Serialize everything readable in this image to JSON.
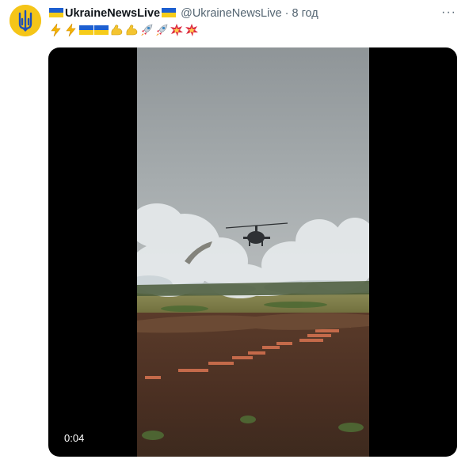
{
  "tweet": {
    "display_name": "UkraineNewsLive",
    "handle": "@UkraineNewsLive",
    "separator": "·",
    "time": "8 год",
    "more_label": "···",
    "emojis": [
      "lightning-icon",
      "lightning-icon",
      "ukraine-flag-icon",
      "ukraine-flag-icon",
      "flexed-biceps-icon",
      "flexed-biceps-icon",
      "rocket-icon",
      "rocket-icon",
      "collision-icon",
      "collision-icon"
    ]
  },
  "video": {
    "timestamp": "0:04"
  },
  "colors": {
    "flag_blue": "#1d5fd0",
    "flag_yellow": "#f6cc1a",
    "secondary_text": "#536471"
  }
}
